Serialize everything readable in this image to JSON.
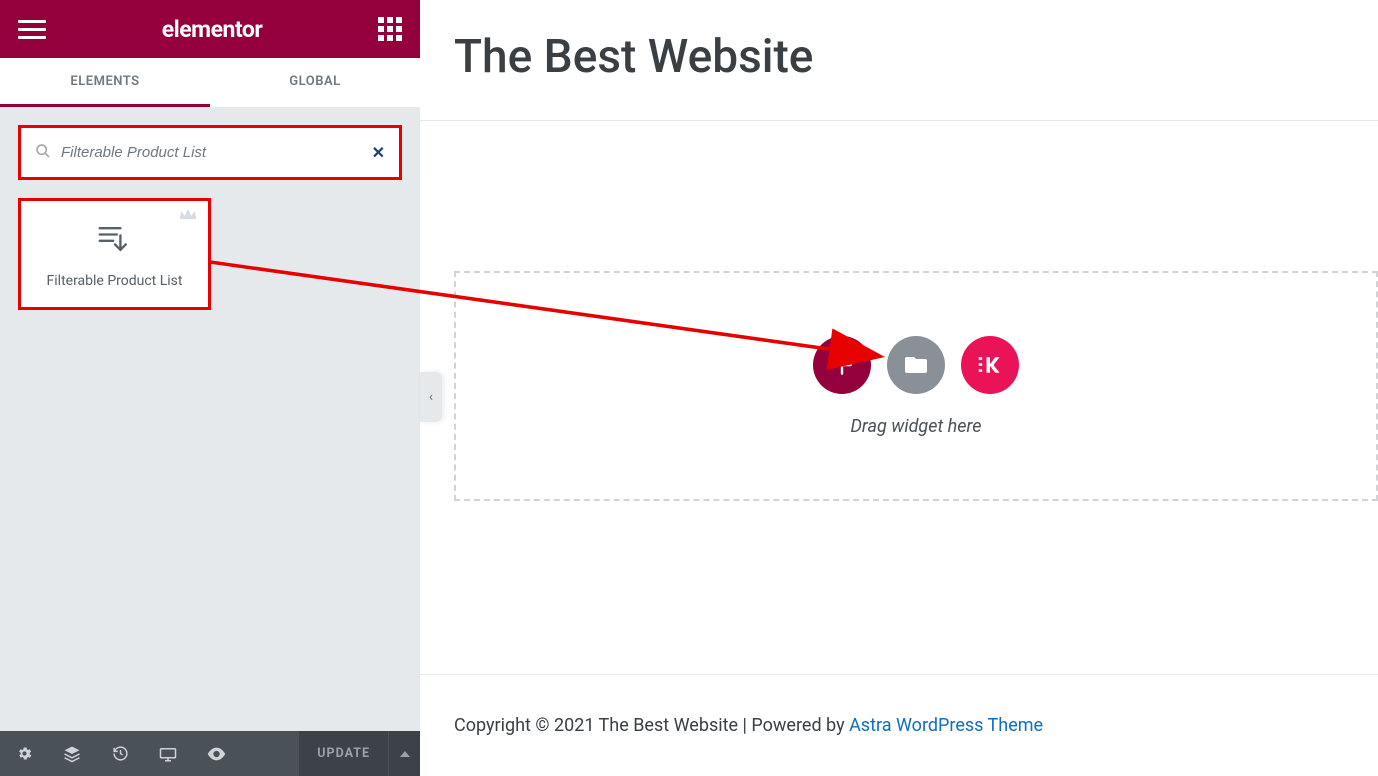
{
  "header": {
    "logo": "elementor"
  },
  "tabs": {
    "elements": "ELEMENTS",
    "global": "GLOBAL"
  },
  "search": {
    "value": "Filterable Product List"
  },
  "widgets": {
    "filterable_product_list": "Filterable Product List"
  },
  "footer": {
    "update": "UPDATE"
  },
  "page": {
    "title": "The Best Website",
    "drag_hint": "Drag widget here",
    "copyright": "Copyright © 2021 The Best Website | Powered by ",
    "theme_link": "Astra WordPress Theme"
  }
}
